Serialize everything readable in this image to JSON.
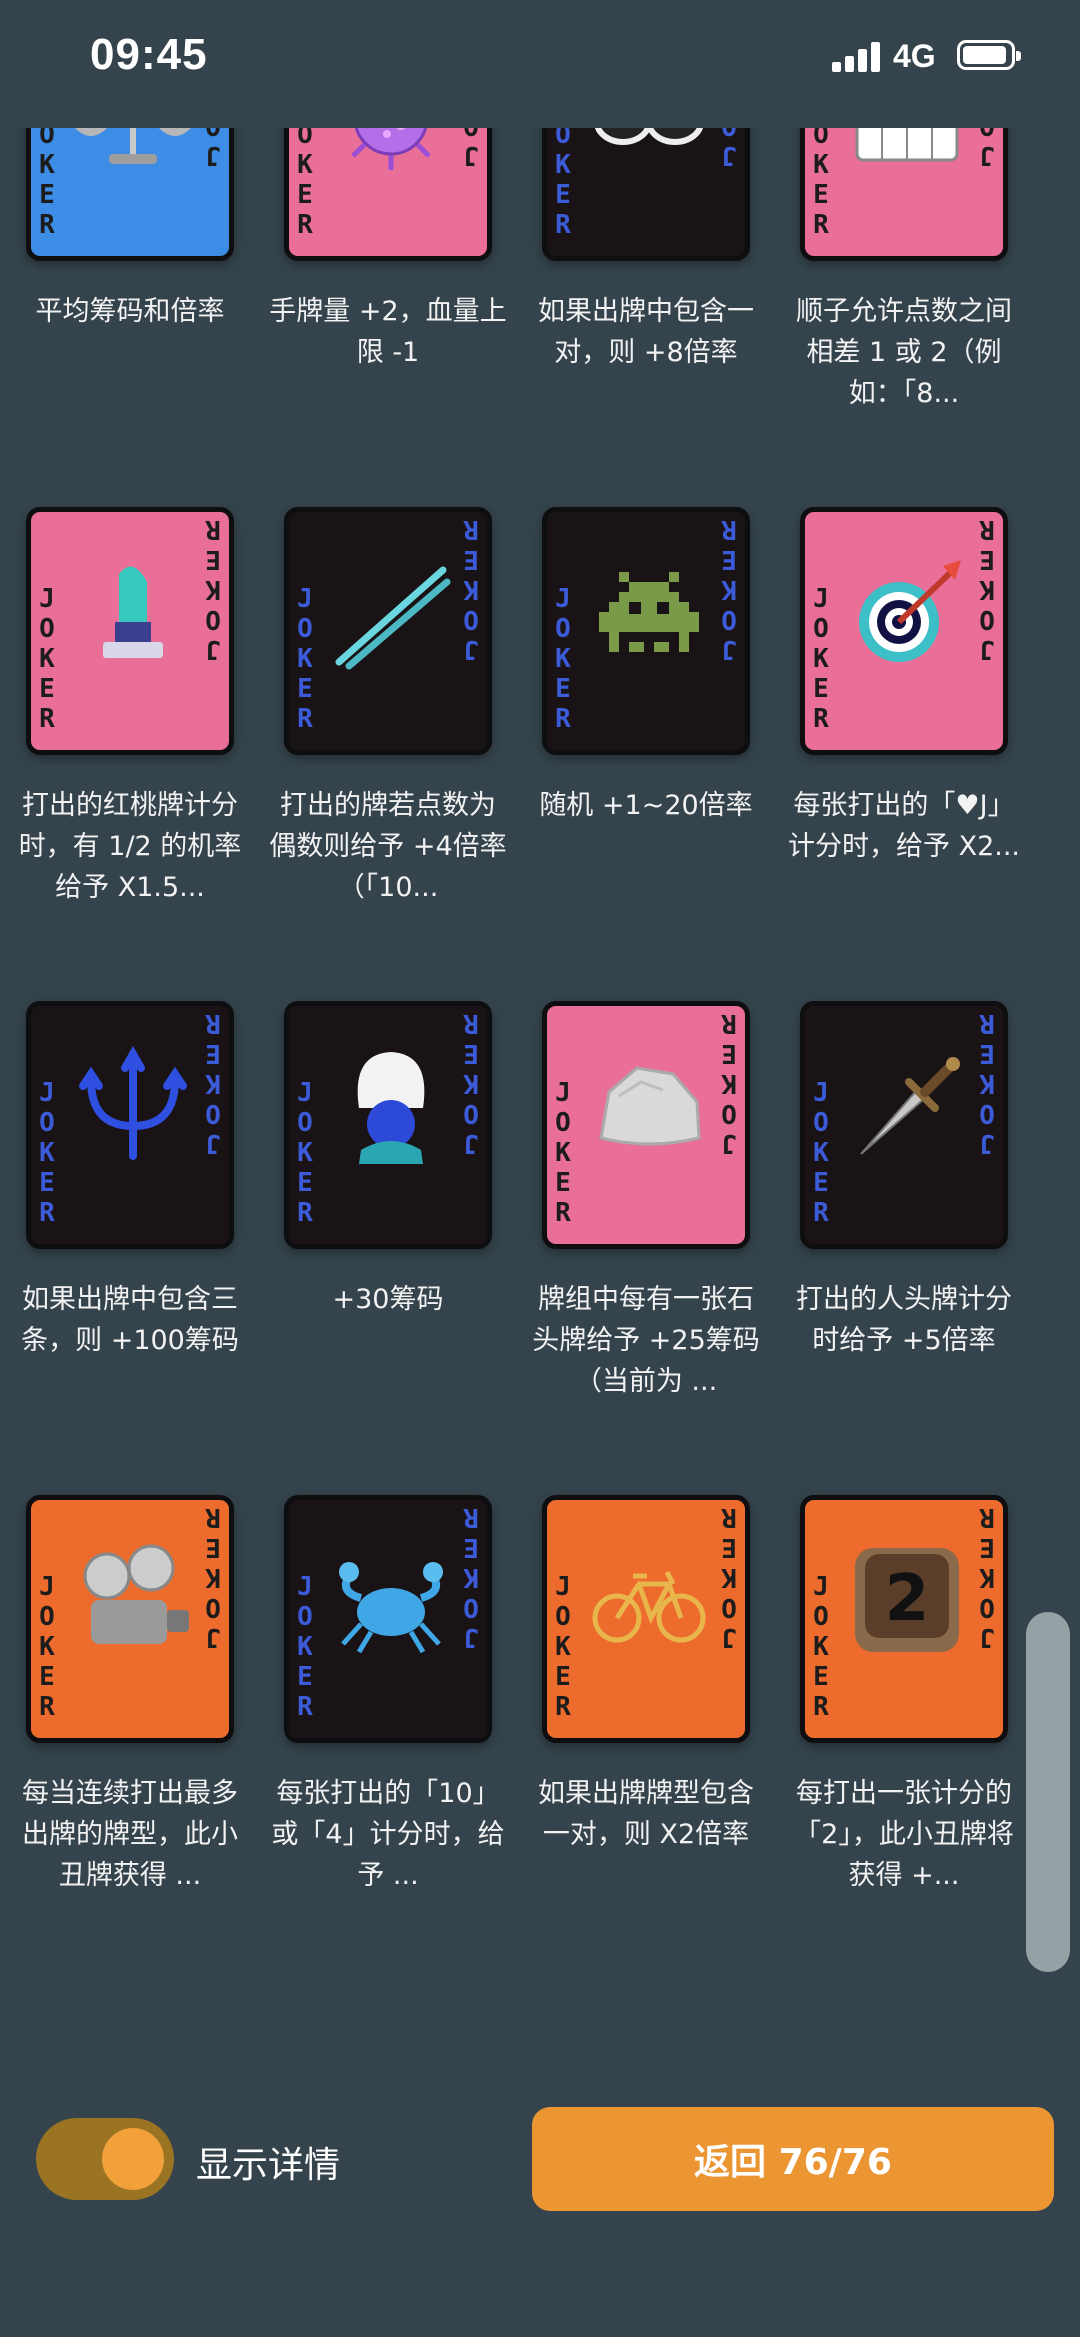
{
  "status_bar": {
    "time": "09:45",
    "network": "4G"
  },
  "cards": [
    {
      "bg": "#3d8ce6",
      "dark": false,
      "icon": "scales-icon",
      "desc": "平均筹码和倍率"
    },
    {
      "bg": "#ea6f98",
      "dark": false,
      "icon": "virus-icon",
      "desc": "手牌量 +2，血量上限 -1"
    },
    {
      "bg": "#1a1316",
      "dark": true,
      "icon": "sunglasses-icon",
      "desc": "如果出牌中包含一对，则 +8倍率"
    },
    {
      "bg": "#ea6f98",
      "dark": false,
      "icon": "piano-icon",
      "desc": "顺子允许点数之间相差 1 或 2（例如：「8..."
    },
    {
      "bg": "#ea6f98",
      "dark": false,
      "icon": "lipstick-icon",
      "desc": "打出的红桃牌计分时，有 1/2 的机率给予 X1.5..."
    },
    {
      "bg": "#1a1316",
      "dark": true,
      "icon": "chopsticks-icon",
      "desc": "打出的牌若点数为偶数则给予 +4倍率（「10..."
    },
    {
      "bg": "#1a1316",
      "dark": true,
      "icon": "alien-monster-icon",
      "desc": "随机 +1~20倍率"
    },
    {
      "bg": "#ea6f98",
      "dark": false,
      "icon": "dart-target-icon",
      "desc": "每张打出的「♥J」计分时，给予 X2..."
    },
    {
      "bg": "#1a1316",
      "dark": true,
      "icon": "trident-icon",
      "desc": "如果出牌中包含三条，则 +100筹码"
    },
    {
      "bg": "#1a1316",
      "dark": true,
      "icon": "guard-icon",
      "desc": "+30筹码"
    },
    {
      "bg": "#ea6f98",
      "dark": false,
      "icon": "rock-icon",
      "desc": "牌组中每有一张石头牌给予 +25筹码（当前为 ..."
    },
    {
      "bg": "#1a1316",
      "dark": true,
      "icon": "dagger-icon",
      "desc": "打出的人头牌计分时给予 +5倍率"
    },
    {
      "bg": "#ec6b2d",
      "dark": false,
      "icon": "film-projector-icon",
      "desc": "每当连续打出最多出牌的牌型，此小丑牌获得 ..."
    },
    {
      "bg": "#1a1316",
      "dark": true,
      "icon": "crab-icon",
      "desc": "每张打出的「10」或「4」计分时，给予 ..."
    },
    {
      "bg": "#ec6b2d",
      "dark": false,
      "icon": "bicycle-icon",
      "desc": "如果出牌牌型包含一对，则 X2倍率"
    },
    {
      "bg": "#ec6b2d",
      "dark": false,
      "icon": "keycap-2-icon",
      "desc": "每打出一张计分的「2」，此小丑牌将获得 +..."
    }
  ],
  "card_letters": [
    "J",
    "O",
    "K",
    "E",
    "R"
  ],
  "footer": {
    "toggle_label": "显示详情",
    "toggle_on": true,
    "back_label": "返回 76/76"
  },
  "colors": {
    "background": "#35444c",
    "accent": "#eb9633"
  }
}
